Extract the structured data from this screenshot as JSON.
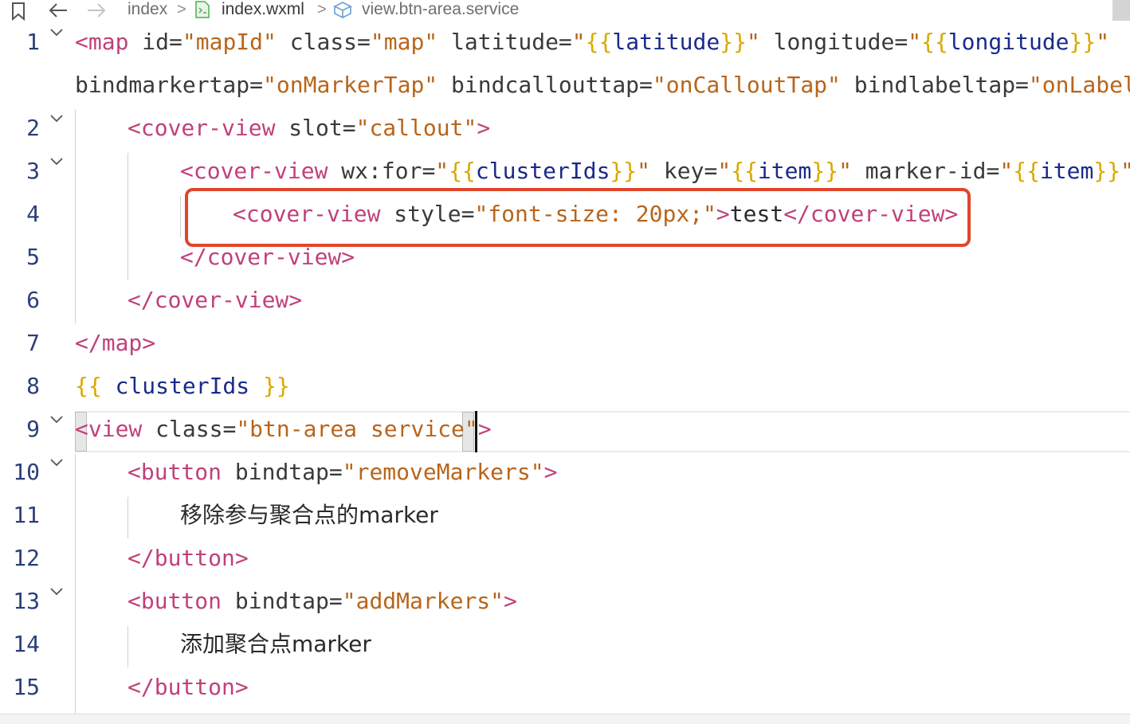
{
  "breadcrumb": {
    "folder": "index",
    "file": "index.wxml",
    "symbol": "view.btn-area.service"
  },
  "icons": {
    "bookmark": "bookmark-icon",
    "back": "arrow-left-icon",
    "forward": "arrow-right-icon",
    "file": "wxml-file-icon",
    "symbol": "cube-icon",
    "fold": "chevron-down-icon"
  },
  "colors": {
    "highlight_box": "#e0452b",
    "tag": "#c0417a",
    "string": "#b8651a",
    "mustache": "#d9a800",
    "variable": "#1a2a8a",
    "file_icon": "#4caf50"
  },
  "lines": [
    {
      "n": "1",
      "tokens": [
        [
          "tag",
          "<map"
        ],
        [
          "attr",
          " id="
        ],
        [
          "str",
          "\"mapId\""
        ],
        [
          "attr",
          " class="
        ],
        [
          "str",
          "\"map\""
        ],
        [
          "attr",
          " latitude="
        ],
        [
          "str",
          "\""
        ],
        [
          "mus",
          "{{"
        ],
        [
          "var",
          "latitude"
        ],
        [
          "mus",
          "}}"
        ],
        [
          "str",
          "\""
        ],
        [
          "attr",
          " longitude="
        ],
        [
          "str",
          "\""
        ],
        [
          "mus",
          "{{"
        ],
        [
          "var",
          "longitude"
        ],
        [
          "mus",
          "}}"
        ],
        [
          "str",
          "\""
        ]
      ]
    },
    {
      "n": "",
      "tokens": [
        [
          "attr",
          "bindmarkertap="
        ],
        [
          "str",
          "\"onMarkerTap\""
        ],
        [
          "attr",
          " bindcallouttap="
        ],
        [
          "str",
          "\"onCalloutTap\""
        ],
        [
          "attr",
          " bindlabeltap="
        ],
        [
          "str",
          "\"onLabelTap"
        ]
      ]
    },
    {
      "n": "2",
      "tokens": [
        [
          "tag",
          "<cover-view"
        ],
        [
          "attr",
          " slot="
        ],
        [
          "str",
          "\"callout\""
        ],
        [
          "br",
          ">"
        ]
      ]
    },
    {
      "n": "3",
      "tokens": [
        [
          "tag",
          "<cover-view"
        ],
        [
          "attr",
          " wx:for="
        ],
        [
          "str",
          "\""
        ],
        [
          "mus",
          "{{"
        ],
        [
          "var",
          "clusterIds"
        ],
        [
          "mus",
          "}}"
        ],
        [
          "str",
          "\""
        ],
        [
          "attr",
          " key="
        ],
        [
          "str",
          "\""
        ],
        [
          "mus",
          "{{"
        ],
        [
          "var",
          "item"
        ],
        [
          "mus",
          "}}"
        ],
        [
          "str",
          "\""
        ],
        [
          "attr",
          " marker-id="
        ],
        [
          "str",
          "\""
        ],
        [
          "mus",
          "{{"
        ],
        [
          "var",
          "item"
        ],
        [
          "mus",
          "}}"
        ],
        [
          "str",
          "\""
        ],
        [
          "br",
          ">"
        ]
      ]
    },
    {
      "n": "4",
      "tokens": [
        [
          "tag",
          "<cover-view"
        ],
        [
          "attr",
          " style="
        ],
        [
          "str",
          "\"font-size: 20px;\""
        ],
        [
          "br",
          ">"
        ],
        [
          "txt",
          "test"
        ],
        [
          "tag",
          "</cover-view"
        ],
        [
          "br",
          ">"
        ]
      ]
    },
    {
      "n": "5",
      "tokens": [
        [
          "tag",
          "</cover-view"
        ],
        [
          "br",
          ">"
        ]
      ]
    },
    {
      "n": "6",
      "tokens": [
        [
          "tag",
          "</cover-view"
        ],
        [
          "br",
          ">"
        ]
      ]
    },
    {
      "n": "7",
      "tokens": [
        [
          "tag",
          "</map"
        ],
        [
          "br",
          ">"
        ]
      ]
    },
    {
      "n": "8",
      "tokens": [
        [
          "mus",
          "{{"
        ],
        [
          "var",
          " clusterIds "
        ],
        [
          "mus",
          "}}"
        ]
      ]
    },
    {
      "n": "9",
      "tokens": [
        [
          "tag",
          "<view"
        ],
        [
          "attr",
          " class="
        ],
        [
          "str",
          "\"btn-area service\""
        ],
        [
          "br",
          ">"
        ]
      ]
    },
    {
      "n": "10",
      "tokens": [
        [
          "tag",
          "<button"
        ],
        [
          "attr",
          " bindtap="
        ],
        [
          "str",
          "\"removeMarkers\""
        ],
        [
          "br",
          ">"
        ]
      ]
    },
    {
      "n": "11",
      "tokens": [
        [
          "txt",
          "移除参与聚合点的marker"
        ]
      ]
    },
    {
      "n": "12",
      "tokens": [
        [
          "tag",
          "</button"
        ],
        [
          "br",
          ">"
        ]
      ]
    },
    {
      "n": "13",
      "tokens": [
        [
          "tag",
          "<button"
        ],
        [
          "attr",
          " bindtap="
        ],
        [
          "str",
          "\"addMarkers\""
        ],
        [
          "br",
          ">"
        ]
      ]
    },
    {
      "n": "14",
      "tokens": [
        [
          "txt",
          "添加聚合点marker"
        ]
      ]
    },
    {
      "n": "15",
      "tokens": [
        [
          "tag",
          "</button"
        ],
        [
          "br",
          ">"
        ]
      ]
    }
  ]
}
